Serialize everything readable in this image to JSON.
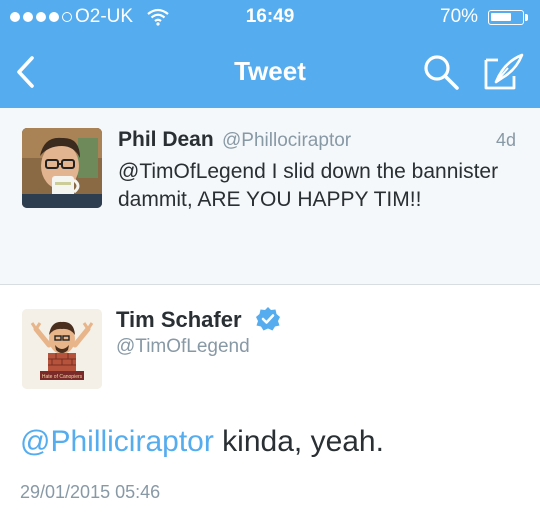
{
  "status_bar": {
    "carrier": "O2-UK",
    "time": "16:49",
    "battery": "70%",
    "battery_level": 0.7,
    "signal_bars_filled": 4,
    "signal_bars_total": 5
  },
  "nav": {
    "title": "Tweet",
    "icons": [
      "back-chevron-icon",
      "search-icon",
      "compose-icon"
    ]
  },
  "parent_tweet": {
    "name": "Phil Dean",
    "handle": "@Phillociraptor",
    "age": "4d",
    "text": "@TimOfLegend I slid down the bannister dammit, ARE YOU HAPPY TIM!!"
  },
  "main_tweet": {
    "name": "Tim Schafer",
    "handle": "@TimOfLegend",
    "verified": true,
    "mention": "@Philliciraptor",
    "body": " kinda, yeah.",
    "timestamp": "29/01/2015 05:46",
    "banner_text": "Hate of Canopiers"
  },
  "colors": {
    "brand_blue": "#55acee",
    "text_dark": "#292f33",
    "text_gray": "#8899a6",
    "parent_bg": "#f5f8fa"
  }
}
